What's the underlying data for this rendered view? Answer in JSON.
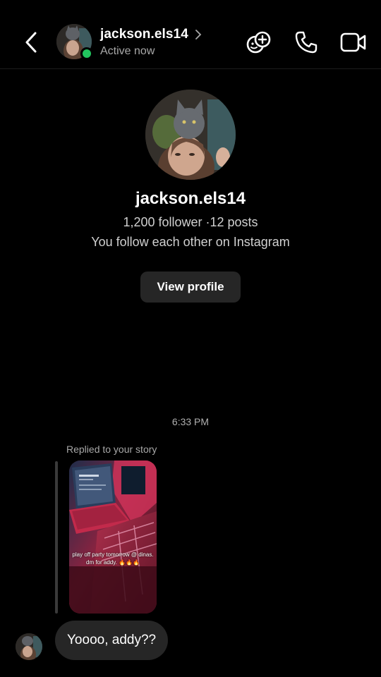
{
  "header": {
    "username": "jackson.els14",
    "status": "Active now",
    "icons": {
      "back": "chevron-left-icon",
      "chevron": "chevron-right-icon",
      "effects": "add-effects-icon",
      "call": "phone-icon",
      "video": "video-camera-icon"
    },
    "online_color": "#22c55e"
  },
  "profile": {
    "username": "jackson.els14",
    "stats": "1,200 follower ·12 posts",
    "mutual": "You follow each other on Instagram",
    "view_profile_label": "View profile"
  },
  "chat": {
    "timestamp": "6:33 PM",
    "replied_label": "Replied to your story",
    "story": {
      "caption": "play off party tomorrow @ dinas. dm for addy. 🔥🔥🔥"
    },
    "message": "Yoooo, addy??"
  },
  "colors": {
    "background": "#000000",
    "bubble": "#262626",
    "button": "#262626",
    "secondary_text": "#a8a8a8"
  }
}
